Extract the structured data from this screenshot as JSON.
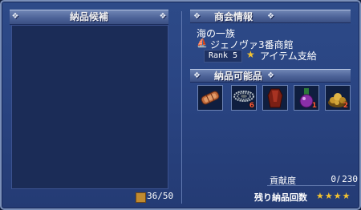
{
  "candidates": {
    "title": "納品候補",
    "capacity": "36/50"
  },
  "guild_info": {
    "title": "商会情報",
    "guild_name": "海の一族",
    "shop_icon": "ship-icon",
    "shop_name": "ジェノヴァ3番商館",
    "rank": "Rank 5",
    "perk": "アイテム支給"
  },
  "deliverable": {
    "title": "納品可能品",
    "items": [
      {
        "icon": "ingot-bundle-icon",
        "count": ""
      },
      {
        "icon": "chain-coil-icon",
        "count": "6"
      },
      {
        "icon": "red-cloth-icon",
        "count": ""
      },
      {
        "icon": "purple-flask-icon",
        "count": "1"
      },
      {
        "icon": "gold-ore-pile-icon",
        "count": "2"
      }
    ]
  },
  "contribution": {
    "label": "貢献度",
    "current": "0",
    "separator": "/",
    "max": "230"
  },
  "remaining": {
    "label": "残り納品回数",
    "stars": "★★★★"
  },
  "colors": {
    "star": "#f3c330",
    "count": "#ff5a36",
    "panel": "#2a4583"
  }
}
